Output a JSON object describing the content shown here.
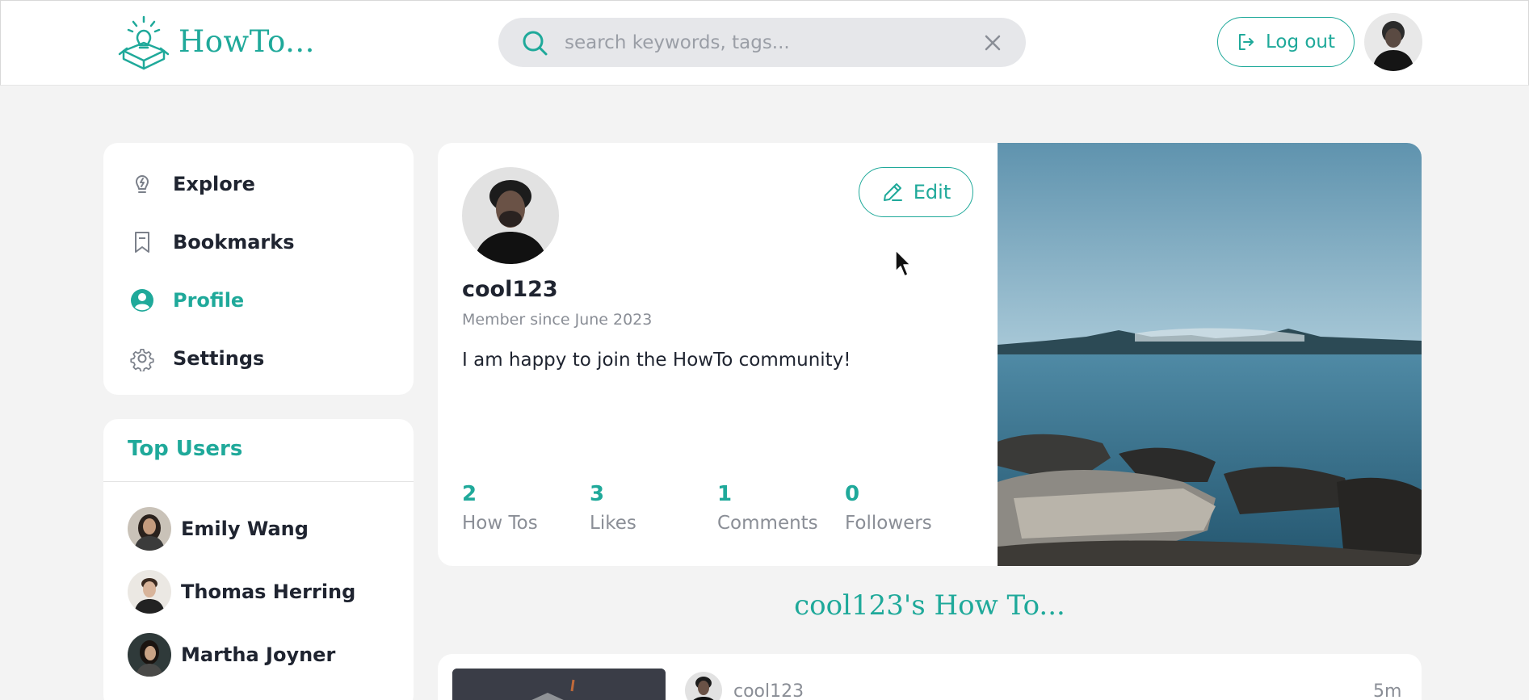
{
  "header": {
    "logo_text": "HowTo...",
    "search_placeholder": "search keywords, tags...",
    "logout_label": "Log out"
  },
  "nav": {
    "items": [
      {
        "label": "Explore",
        "icon": "lightbulb-icon"
      },
      {
        "label": "Bookmarks",
        "icon": "bookmark-icon"
      },
      {
        "label": "Profile",
        "icon": "user-circle-icon",
        "active": true
      },
      {
        "label": "Settings",
        "icon": "gear-icon"
      }
    ]
  },
  "top_users": {
    "title": "Top Users",
    "users": [
      "Emily Wang",
      "Thomas Herring",
      "Martha Joyner"
    ]
  },
  "profile": {
    "username": "cool123",
    "member_since": "Member since June 2023",
    "bio": "I am happy to join the HowTo community!",
    "edit_label": "Edit",
    "stats": [
      {
        "value": "2",
        "label": "How Tos"
      },
      {
        "value": "3",
        "label": "Likes"
      },
      {
        "value": "1",
        "label": "Comments"
      },
      {
        "value": "0",
        "label": "Followers"
      }
    ]
  },
  "section": {
    "title": "cool123's How To..."
  },
  "post": {
    "author": "cool123",
    "time": "5m"
  },
  "colors": {
    "accent": "#1fa99a",
    "background": "#f3f3f3",
    "card": "#ffffff"
  }
}
